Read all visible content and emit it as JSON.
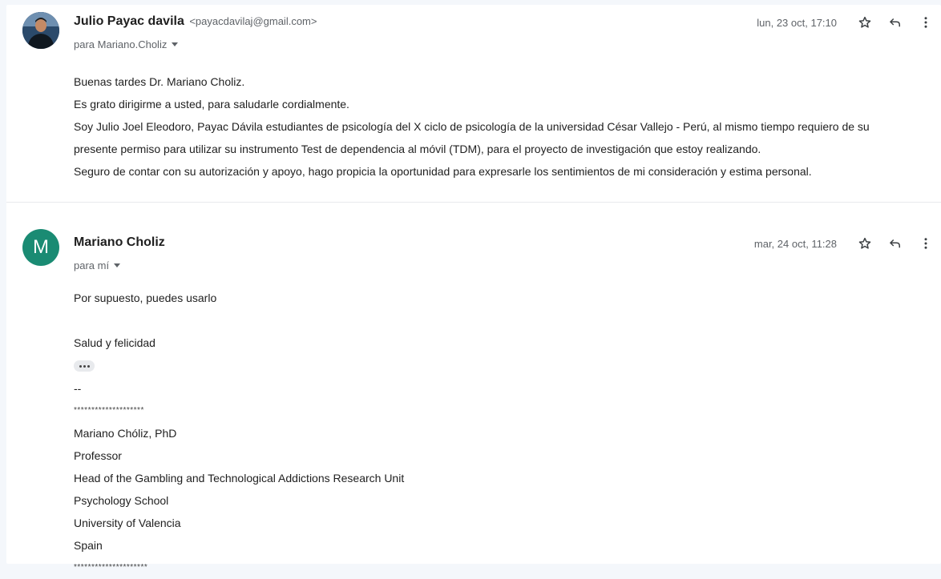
{
  "messages": [
    {
      "sender_name": "Julio Payac davila",
      "sender_email": "<payacdavilaj@gmail.com>",
      "to": "para Mariano.Choliz",
      "date": "lun, 23 oct, 17:10",
      "body": [
        "Buenas tardes Dr. Mariano Choliz.",
        "Es grato dirigirme a usted, para saludarle cordialmente.",
        "Soy Julio Joel Eleodoro, Payac Dávila estudiantes de psicología del X ciclo de psicología de la universidad César Vallejo -  Perú, al mismo tiempo requiero de su",
        "presente permiso para utilizar su instrumento Test de dependencia al móvil (TDM), para el proyecto de investigación que estoy realizando.",
        "Seguro de contar con su autorización y apoyo, hago propicia la oportunidad para expresarle los sentimientos de mi consideración y estima personal."
      ]
    },
    {
      "avatar_letter": "M",
      "sender_name": "Mariano Choliz",
      "to": "para mí",
      "date": "mar, 24 oct, 11:28",
      "body_main": "Por supuesto, puedes usarlo",
      "closing": "Salud y felicidad",
      "sig_dash": "--",
      "sig_stars_top": "********************",
      "signature": [
        "Mariano Chóliz, PhD",
        "Professor",
        "Head of the Gambling and Technological Addictions Research Unit",
        "Psychology School",
        "University of Valencia",
        "Spain"
      ],
      "sig_stars_bottom": "*********************"
    }
  ],
  "icons": {
    "star": "star-icon",
    "reply": "reply-icon",
    "more": "more-vert-icon",
    "dropdown": "caret-down-icon",
    "show_trimmed": "ellipsis-icon"
  },
  "colors": {
    "avatar_m": "#1a8b73",
    "secondary_text": "#5f6368"
  }
}
